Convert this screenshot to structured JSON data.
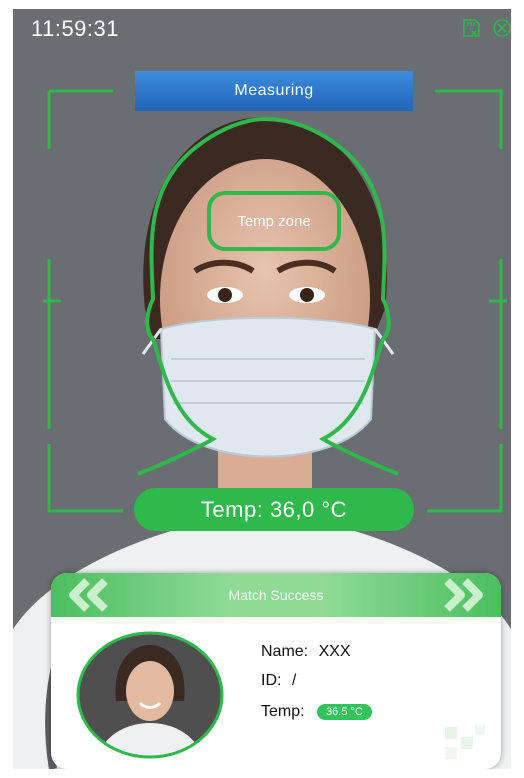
{
  "status_bar": {
    "time": "11:59:31"
  },
  "measuring_label": "Measuring",
  "temp_zone_label": "Temp zone",
  "temp_reading": "Temp: 36,0 °C",
  "match_card": {
    "title": "Match Success",
    "name_label": "Name:",
    "name_value": "XXX",
    "id_label": "ID:",
    "id_value": "/",
    "temp_label": "Temp:",
    "temp_value": "36.5 °C"
  },
  "colors": {
    "guide_green": "#2fb84b",
    "measuring_blue": "#2e78cc",
    "background": "#6a6d72"
  }
}
